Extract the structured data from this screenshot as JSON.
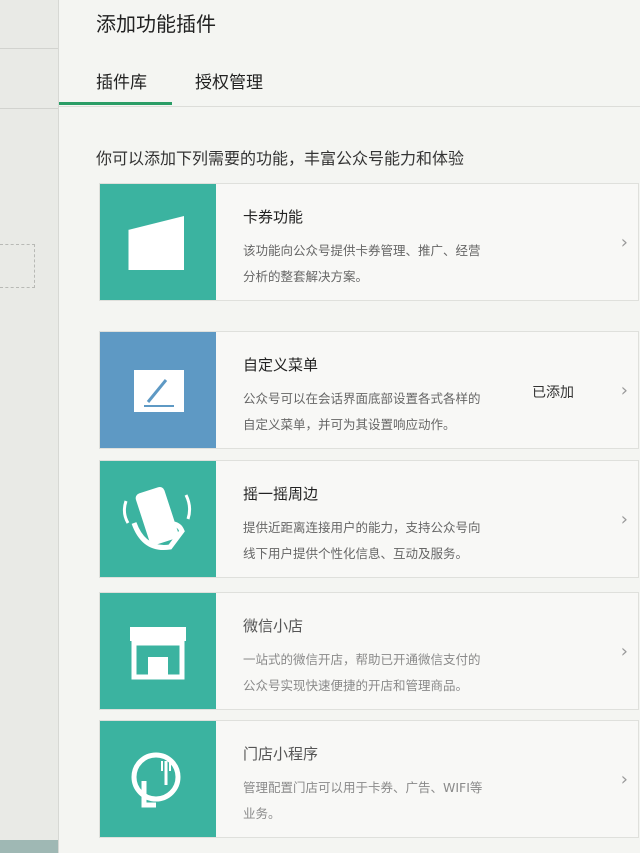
{
  "header": {
    "title": "添加功能插件"
  },
  "tabs": [
    {
      "label": "插件库",
      "active": true
    },
    {
      "label": "授权管理",
      "active": false
    }
  ],
  "intro": "你可以添加下列需要的功能，丰富公众号能力和体验",
  "plugins": [
    {
      "title": "卡券功能",
      "desc1": "该功能向公众号提供卡券管理、推广、经营",
      "desc2": "分析的整套解决方案。",
      "status": "",
      "icon": "card-icon",
      "icon_color": "#3bb3a0"
    },
    {
      "title": "自定义菜单",
      "desc1": "公众号可以在会话界面底部设置各式各样的",
      "desc2": "自定义菜单，并可为其设置响应动作。",
      "status": "已添加",
      "icon": "edit-menu-icon",
      "icon_color": "#5e99c4"
    },
    {
      "title": "摇一摇周边",
      "desc1": "提供近距离连接用户的能力，支持公众号向",
      "desc2": "线下用户提供个性化信息、互动及服务。",
      "status": "",
      "icon": "shake-phone-icon",
      "icon_color": "#3bb3a0"
    },
    {
      "title": "微信小店",
      "desc1": "一站式的微信开店，帮助已开通微信支付的",
      "desc2": "公众号实现快速便捷的开店和管理商品。",
      "status": "",
      "icon": "store-icon",
      "icon_color": "#3bb3a0"
    },
    {
      "title": "门店小程序",
      "desc1": "管理配置门店可以用于卡券、广告、WIFI等",
      "desc2": "业务。",
      "status": "",
      "icon": "location-pin-icon",
      "icon_color": "#3bb3a0"
    }
  ],
  "chevron_glyph": "›"
}
